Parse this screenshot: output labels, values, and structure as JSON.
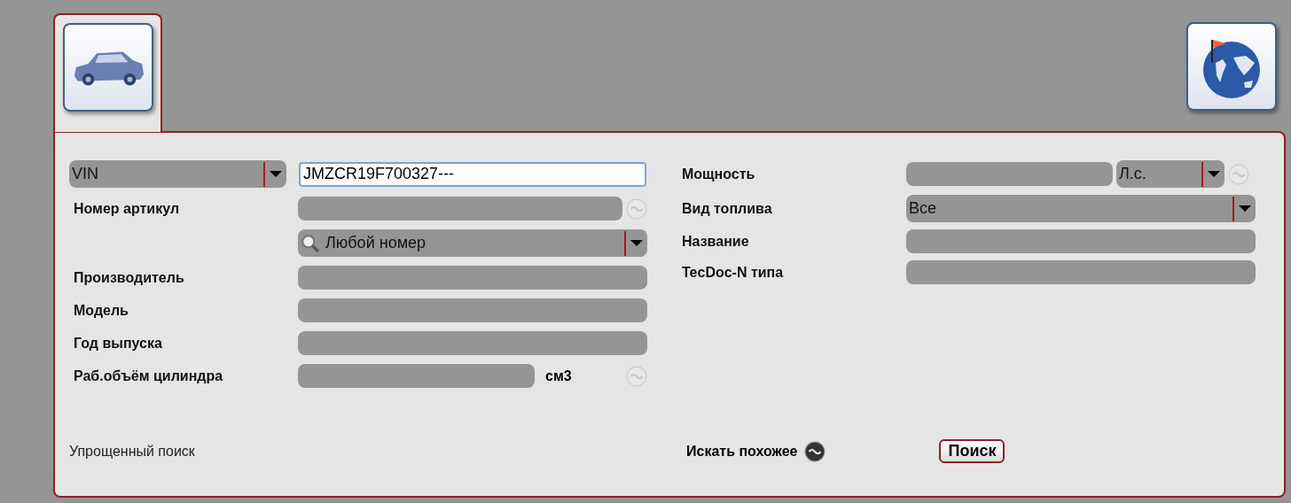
{
  "tabs": [
    {
      "kind": "car",
      "selected": true
    }
  ],
  "search_type": {
    "value": "VIN"
  },
  "vin_field": {
    "value": "JMZCR19F700327---",
    "focused": true
  },
  "left_rows": [
    {
      "kind": "text",
      "label": "Номер артикул",
      "refresh_disabled": true
    },
    {
      "kind": "select",
      "value": "Любой номер"
    },
    {
      "kind": "text",
      "label": "Производитель"
    },
    {
      "kind": "text",
      "label": "Модель"
    },
    {
      "kind": "text",
      "label": "Год выпуска"
    },
    {
      "kind": "unit",
      "label": "Раб.объём цилиндра",
      "unit": "см3",
      "refresh_disabled": true
    }
  ],
  "right_rows": [
    {
      "kind": "unit_select",
      "label": "Мощность",
      "unit": "Л.с.",
      "refresh_disabled": true
    },
    {
      "kind": "select",
      "label": "Вид топлива",
      "value": "Все"
    },
    {
      "kind": "text",
      "label": "Название"
    },
    {
      "kind": "text",
      "label": "TecDoc-N типа"
    }
  ],
  "footer": {
    "simple_search": "Упрощенный поиск",
    "similar": {
      "label": "Искать похожее",
      "disabled": false
    },
    "search_button": "Поиск"
  }
}
